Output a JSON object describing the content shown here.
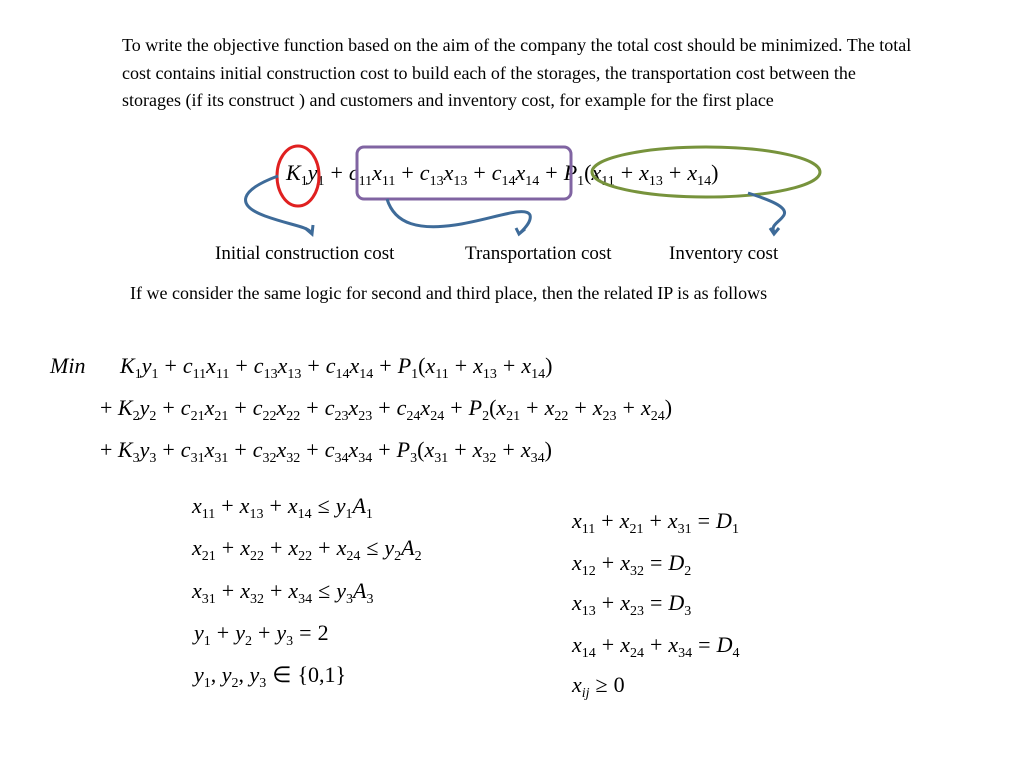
{
  "intro_text": "To write the objective function based on the aim of the company the total cost should be minimized. The total cost contains initial construction cost to build each of the storages, the transportation cost between the storages (if its construct ) and customers and inventory cost, for example for the first place",
  "example_expression": {
    "construction_term": "K1 y1",
    "transportation_term": "c11 x11 + c13 x13 + c14 x14",
    "inventory_term": "P1 (x11 + x13 + x14)"
  },
  "annotation_labels": {
    "construction": "Initial construction cost",
    "transportation": "Transportation cost",
    "inventory": "Inventory cost"
  },
  "annotation_colors": {
    "construction_circle": "#e02020",
    "transportation_box": "#8064a2",
    "inventory_ellipse": "#77933c",
    "arrows": "#3e6b99"
  },
  "logic_text": "If we consider the same logic for second and third place, then the related IP is as follows",
  "objective": {
    "keyword": "Min",
    "rows": [
      "K1 y1 + c11 x11 + c13 x13 + c14 x14 + P1 (x11 + x13 + x14)",
      "+ K2 y2 + c21 x21 + c22 x22 + c23 x23 + c24 x24 + P2 (x21 + x22 + x23 + x24)",
      "+ K3 y3 + c31 x31 + c32 x32 + c34 x34 + P3 (x31 + x32 + x34)"
    ]
  },
  "capacity_constraints": [
    "x11 + x13 + x14 ≤ y1 A1",
    "x21 + x22 + x22 + x24 ≤ y2 A2",
    "x31 + x32 + x34 ≤ y3 A3",
    "y1 + y2 + y3 = 2",
    "y1, y2, y3 ∈ {0,1}"
  ],
  "demand_constraints": [
    "x11 + x21 + x31 = D1",
    "x12 + x32 = D2",
    "x13 + x23 = D3",
    "x14 + x24 + x34 = D4",
    "xij ≥ 0"
  ]
}
